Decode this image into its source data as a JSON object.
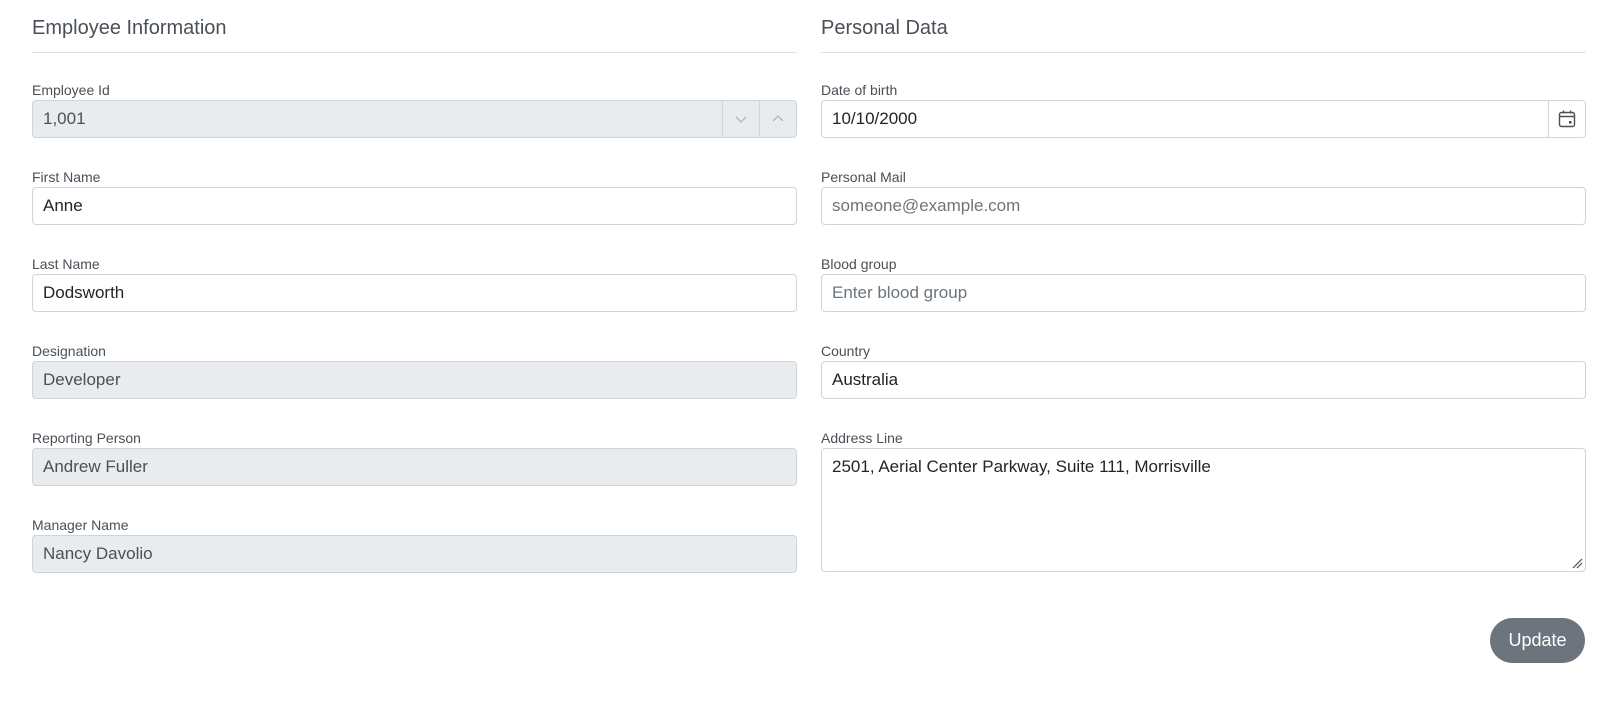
{
  "employee_section": {
    "title": "Employee Information",
    "employee_id": {
      "label": "Employee Id",
      "value": "1,001",
      "decrement_icon": "chevron-down-icon",
      "increment_icon": "chevron-up-icon"
    },
    "first_name": {
      "label": "First Name",
      "value": "Anne"
    },
    "last_name": {
      "label": "Last Name",
      "value": "Dodsworth"
    },
    "designation": {
      "label": "Designation",
      "value": "Developer"
    },
    "reporting_person": {
      "label": "Reporting Person",
      "value": "Andrew Fuller"
    },
    "manager_name": {
      "label": "Manager Name",
      "value": "Nancy Davolio"
    }
  },
  "personal_section": {
    "title": "Personal Data",
    "date_of_birth": {
      "label": "Date of birth",
      "value": "10/10/2000",
      "icon": "calendar-icon"
    },
    "personal_mail": {
      "label": "Personal Mail",
      "value": "",
      "placeholder": "someone@example.com"
    },
    "blood_group": {
      "label": "Blood group",
      "value": "",
      "placeholder": "Enter blood group"
    },
    "country": {
      "label": "Country",
      "value": "Australia"
    },
    "address_line": {
      "label": "Address Line",
      "value": "2501, Aerial Center Parkway, Suite 111, Morrisville"
    }
  },
  "actions": {
    "update_label": "Update"
  },
  "colors": {
    "border": "#ced4da",
    "disabled_bg": "#e9ecef",
    "button_bg": "#6c757d",
    "placeholder": "#6c757d"
  }
}
